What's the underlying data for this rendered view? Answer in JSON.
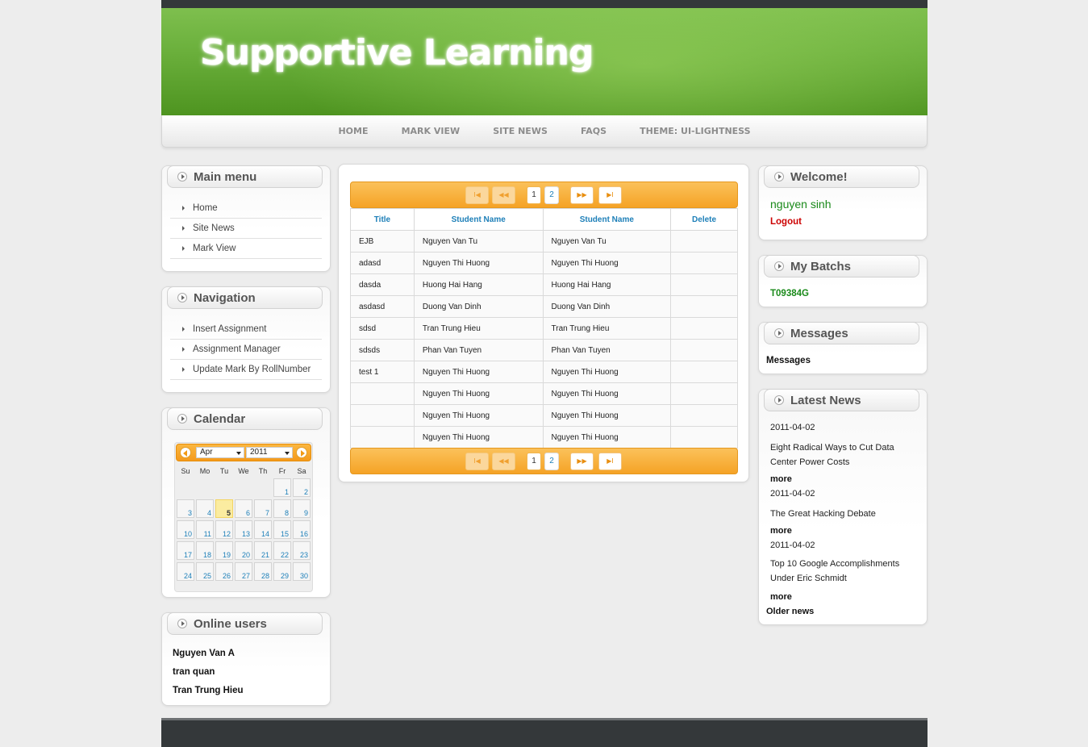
{
  "site": {
    "title": "Supportive Learning"
  },
  "nav": [
    "HOME",
    "MARK VIEW",
    "SITE NEWS",
    "FAQS",
    "THEME: UI-LIGHTNESS"
  ],
  "main_menu": {
    "title": "Main menu",
    "items": [
      "Home",
      "Site News",
      "Mark View"
    ]
  },
  "navigation": {
    "title": "Navigation",
    "items": [
      "Insert Assignment",
      "Assignment Manager",
      "Update Mark By RollNumber"
    ]
  },
  "calendar": {
    "title": "Calendar",
    "month": "Apr",
    "year": "2011",
    "days_of_week": [
      "Su",
      "Mo",
      "Tu",
      "We",
      "Th",
      "Fr",
      "Sa"
    ],
    "leading_blanks": 5,
    "days": [
      "1",
      "2",
      "3",
      "4",
      "5",
      "6",
      "7",
      "8",
      "9",
      "10",
      "11",
      "12",
      "13",
      "14",
      "15",
      "16",
      "17",
      "18",
      "19",
      "20",
      "21",
      "22",
      "23",
      "24",
      "25",
      "26",
      "27",
      "28",
      "29",
      "30"
    ],
    "today": "5"
  },
  "online_users": {
    "title": "Online users",
    "users": [
      "Nguyen Van A",
      "tran quan",
      "Tran Trung Hieu"
    ]
  },
  "table": {
    "headers": [
      "Title",
      "Student Name",
      "Student Name",
      "Delete"
    ],
    "rows": [
      [
        "EJB",
        "Nguyen Van Tu",
        "Nguyen Van Tu",
        ""
      ],
      [
        "adasd",
        "Nguyen Thi Huong",
        "Nguyen Thi Huong",
        ""
      ],
      [
        "dasda",
        "Huong Hai Hang",
        "Huong Hai Hang",
        ""
      ],
      [
        "asdasd",
        "Duong Van Dinh",
        "Duong Van Dinh",
        ""
      ],
      [
        "sdsd",
        "Tran Trung Hieu",
        "Tran Trung Hieu",
        ""
      ],
      [
        "sdsds",
        "Phan Van Tuyen",
        "Phan Van Tuyen",
        ""
      ],
      [
        "test 1",
        "Nguyen Thi Huong",
        "Nguyen Thi Huong",
        ""
      ],
      [
        "",
        "Nguyen Thi Huong",
        "Nguyen Thi Huong",
        ""
      ],
      [
        "",
        "Nguyen Thi Huong",
        "Nguyen Thi Huong",
        ""
      ],
      [
        "",
        "Nguyen Thi Huong",
        "Nguyen Thi Huong",
        ""
      ]
    ],
    "pager": {
      "first": "I◀",
      "prev": "◀◀",
      "pages": [
        "1",
        "2"
      ],
      "current_page": "1",
      "next": "▶▶",
      "last": "▶I"
    }
  },
  "welcome": {
    "title": "Welcome!",
    "username": "nguyen sinh",
    "logout": "Logout"
  },
  "batches": {
    "title": "My Batchs",
    "items": [
      "T09384G"
    ]
  },
  "messages": {
    "title": "Messages",
    "label": "Messages"
  },
  "news": {
    "title": "Latest News",
    "items": [
      {
        "date": "2011-04-02",
        "headline": "Eight Radical Ways to Cut Data Center Power Costs",
        "more": "more"
      },
      {
        "date": "2011-04-02",
        "headline": "The Great Hacking Debate",
        "more": "more"
      },
      {
        "date": "2011-04-02",
        "headline": "Top 10 Google Accomplishments Under Eric Schmidt",
        "more": "more"
      }
    ],
    "older": "Older news"
  },
  "colors": {
    "header_green": "#6bb03c",
    "accent_orange": "#f5a326",
    "link_blue": "#1d7fb8",
    "username_green": "#1a8a1a",
    "logout_red": "#cc0000"
  }
}
